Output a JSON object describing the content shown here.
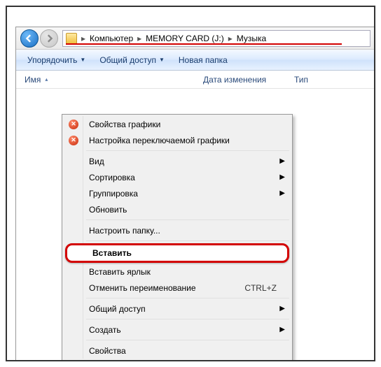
{
  "breadcrumb": {
    "seg0": "Компьютер",
    "seg1": "MEMORY CARD (J:)",
    "seg2": "Музыка"
  },
  "toolbar": {
    "organize": "Упорядочить",
    "share": "Общий доступ",
    "newfolder": "Новая папка"
  },
  "headers": {
    "name": "Имя",
    "date": "Дата изменения",
    "type": "Тип"
  },
  "menu": {
    "gfx_props": "Свойства графики",
    "gfx_switch": "Настройка переключаемой графики",
    "view": "Вид",
    "sort": "Сортировка",
    "group": "Группировка",
    "refresh": "Обновить",
    "customize": "Настроить папку...",
    "paste": "Вставить",
    "paste_shortcut": "Вставить ярлык",
    "undo_rename": "Отменить переименование",
    "undo_key": "CTRL+Z",
    "share": "Общий доступ",
    "new": "Создать",
    "properties": "Свойства"
  }
}
